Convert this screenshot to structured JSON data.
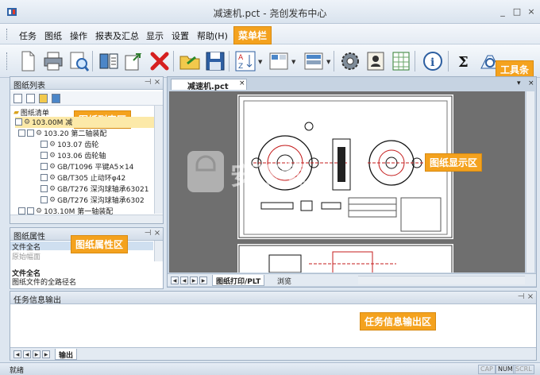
{
  "window": {
    "title": "减速机.pct - 尧创发布中心",
    "controls": [
      "_",
      "□",
      "×"
    ]
  },
  "menubar": {
    "items": [
      "任务",
      "图纸",
      "操作",
      "报表及汇总",
      "显示",
      "设置",
      "帮助(H)"
    ],
    "callout": "菜单栏"
  },
  "toolbar": {
    "callout": "工具条",
    "buttons": [
      "new-document",
      "print",
      "print-preview",
      "open-list",
      "export",
      "delete",
      "open-folder",
      "save",
      "sort-az",
      "layout-columns",
      "layout-rows",
      "settings-gear",
      "user-card",
      "spreadsheet",
      "info",
      "sum",
      "search"
    ]
  },
  "drawing_list": {
    "title": "图纸列表",
    "callout": "图纸列表区",
    "root": "图纸清单",
    "rows": [
      {
        "indent": 0,
        "text": "103.00M 减"
      },
      {
        "indent": 1,
        "text": "103.20 第二轴装配"
      },
      {
        "indent": 2,
        "text": "103.07 齿轮"
      },
      {
        "indent": 2,
        "text": "103.06 齿轮轴"
      },
      {
        "indent": 2,
        "text": "GB/T1096 平键A5×14"
      },
      {
        "indent": 2,
        "text": "GB/T305 止动环φ42"
      },
      {
        "indent": 2,
        "text": "GB/T276 深沟球轴承63021"
      },
      {
        "indent": 2,
        "text": "GB/T276 深沟球轴承6302"
      },
      {
        "indent": 1,
        "text": "103.10M 第一轴装配"
      }
    ]
  },
  "drawing_props": {
    "title": "图纸属性",
    "callout": "图纸属性区",
    "rows": [
      "文件全名",
      "原始幅面"
    ],
    "desc_title": "文件全名",
    "desc_text": "图纸文件的全路径名"
  },
  "document": {
    "tab": "减速机.pct",
    "callout": "图纸显示区",
    "bottom_tabs": [
      "图纸打印/PLT",
      "浏览"
    ]
  },
  "output": {
    "title": "任务信息输出",
    "callout": "任务信息输出区",
    "tab": "输出"
  },
  "status": {
    "text": "就绪",
    "indicators": [
      "CAP",
      "NUM",
      "SCRL"
    ]
  },
  "watermark": {
    "text": "安下载",
    "sub": "anxz.com"
  },
  "colors": {
    "callout": "#f4a21e",
    "accent": "#3a6ea5"
  }
}
